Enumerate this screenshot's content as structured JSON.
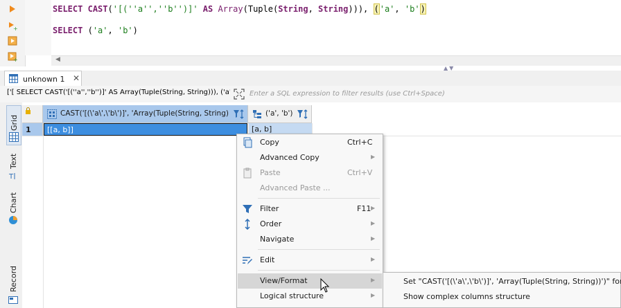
{
  "editor": {
    "line1": {
      "kw1": "SELECT",
      "fn": "CAST",
      "p1": "(",
      "str1": "'[(''a'',''b'')]'",
      "kw2": "AS",
      "t1": "Array",
      "p2": "(",
      "t2": "Tuple",
      "p3": "(",
      "t3": "String",
      "comma": ", ",
      "t4": "String",
      "p4": "))), ",
      "hl_open": "(",
      "str2": "'a'",
      "comma2": ", ",
      "str3": "'b'",
      "hl_close": ")"
    },
    "line2": {
      "kw": "SELECT",
      "p1": "(",
      "s1": "'a'",
      "comma": ", ",
      "s2": "'b'",
      "p2": ")"
    }
  },
  "tab": {
    "label": "unknown 1",
    "close": "✕"
  },
  "filter": {
    "query": "['[ SELECT CAST('[(''a'',''b'')]' AS Array(Tuple(String, String))), ('a'",
    "placeholder": "Enter a SQL expression to filter results (use Ctrl+Space)"
  },
  "side_tabs": {
    "grid": "Grid",
    "text": "Text",
    "chart": "Chart",
    "record": "Record"
  },
  "grid": {
    "columns": [
      "CAST('[(\\'a\\',\\'b\\')]', 'Array(Tuple(String, String))')",
      "('a', 'b')"
    ],
    "rows": [
      {
        "num": "1",
        "cells": [
          "[[a, b]]",
          "[a, b]"
        ]
      }
    ]
  },
  "context_menu": {
    "items": [
      {
        "label": "Copy",
        "shortcut": "Ctrl+C",
        "disabled": false,
        "submenu": false,
        "icon": "copy-icon"
      },
      {
        "label": "Advanced Copy",
        "shortcut": "",
        "disabled": false,
        "submenu": true,
        "icon": ""
      },
      {
        "label": "Paste",
        "shortcut": "Ctrl+V",
        "disabled": true,
        "submenu": false,
        "icon": "paste-icon"
      },
      {
        "label": "Advanced Paste ...",
        "shortcut": "",
        "disabled": true,
        "submenu": false,
        "icon": ""
      },
      {
        "label": "Filter",
        "shortcut": "F11",
        "disabled": false,
        "submenu": true,
        "icon": "filter-icon"
      },
      {
        "label": "Order",
        "shortcut": "",
        "disabled": false,
        "submenu": true,
        "icon": "sort-icon"
      },
      {
        "label": "Navigate",
        "shortcut": "",
        "disabled": false,
        "submenu": true,
        "icon": ""
      },
      {
        "label": "Edit",
        "shortcut": "",
        "disabled": false,
        "submenu": true,
        "icon": "edit-icon"
      },
      {
        "label": "View/Format",
        "shortcut": "",
        "disabled": false,
        "submenu": true,
        "icon": ""
      },
      {
        "label": "Logical structure",
        "shortcut": "",
        "disabled": false,
        "submenu": true,
        "icon": ""
      }
    ]
  },
  "submenu": {
    "items": [
      "Set \"CAST('[(\\'a\\',\\'b\\')]', 'Array(Tuple(String, String))')\" format",
      "Show complex columns structure"
    ]
  },
  "colors": {
    "selection": "#3d8ee0",
    "menu_highlight": "#d6d6d6",
    "header_selected": "#a9c8ec"
  }
}
